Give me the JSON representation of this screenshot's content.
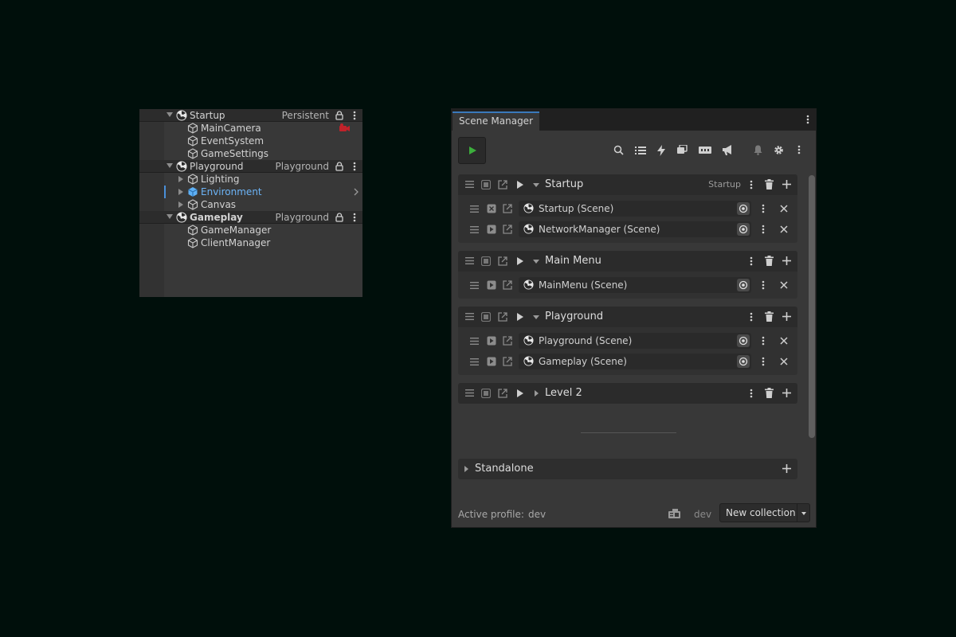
{
  "hierarchy": {
    "rows": [
      {
        "label": "Startup",
        "tag": "Persistent"
      },
      {
        "label": "MainCamera"
      },
      {
        "label": "EventSystem"
      },
      {
        "label": "GameSettings"
      },
      {
        "label": "Playground",
        "tag": "Playground"
      },
      {
        "label": "Lighting"
      },
      {
        "label": "Environment"
      },
      {
        "label": "Canvas"
      },
      {
        "label": "Gameplay",
        "tag": "Playground"
      },
      {
        "label": "GameManager"
      },
      {
        "label": "ClientManager"
      }
    ]
  },
  "scene_manager": {
    "tab": "Scene Manager",
    "collections": [
      {
        "title": "Startup",
        "tag": "Startup",
        "scenes": [
          "Startup (Scene)",
          "NetworkManager (Scene)"
        ]
      },
      {
        "title": "Main Menu",
        "scenes": [
          "MainMenu (Scene)"
        ]
      },
      {
        "title": "Playground",
        "scenes": [
          "Playground (Scene)",
          "Gameplay (Scene)"
        ]
      },
      {
        "title": "Level 2",
        "scenes": []
      }
    ],
    "standalone": "Standalone",
    "footer": {
      "active_profile_label": "Active profile:",
      "active_profile_value": "dev",
      "profile_name": "dev",
      "new_collection": "New collection"
    }
  },
  "colors": {
    "background": "#000f0b",
    "panel": "#383838",
    "selection_text": "#6cb4f7",
    "play_green": "#3cae3c",
    "tab_accent": "#3a79bb"
  },
  "icons": [
    "unity-scene-icon",
    "gameobject-cube-icon",
    "lock-icon",
    "kebab-menu-icon",
    "play-icon",
    "search-icon",
    "list-icon",
    "lightning-icon",
    "stack-icon",
    "ticket-icon",
    "megaphone-icon",
    "bell-icon",
    "gear-icon",
    "trash-icon",
    "plus-icon",
    "close-icon",
    "drag-handle-icon",
    "target-icon"
  ]
}
